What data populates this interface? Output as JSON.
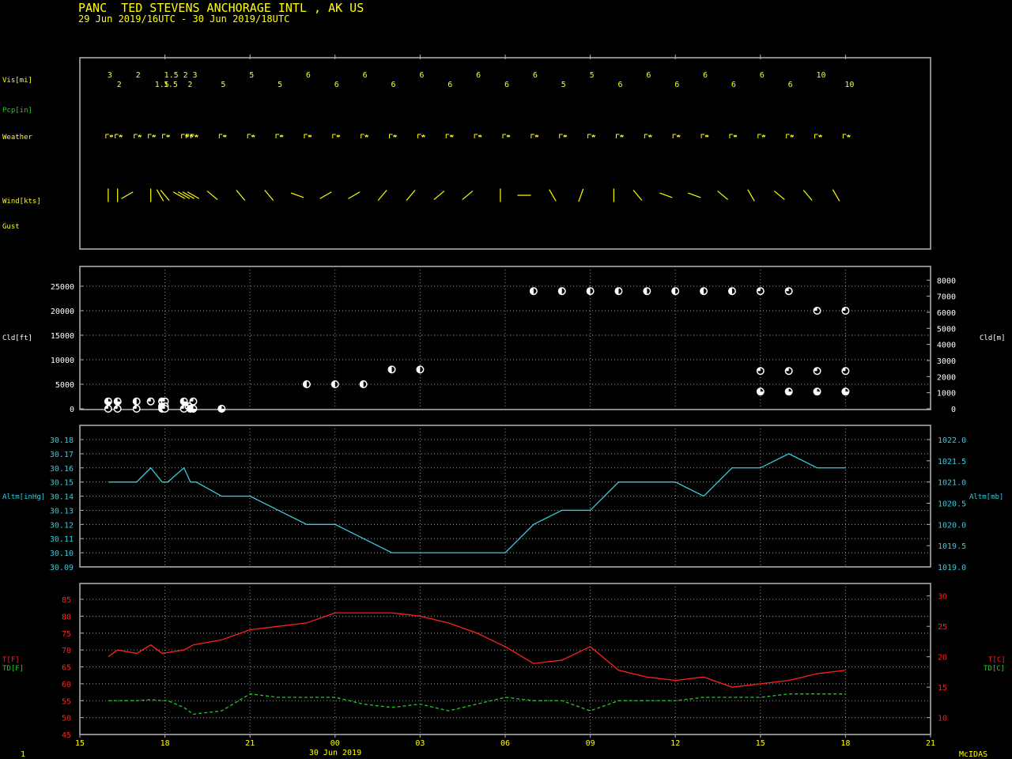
{
  "header": {
    "station_line": "PANC  TED STEVENS ANCHORAGE INTL , AK US",
    "period_line": "29 Jun 2019/16UTC - 30 Jun 2019/18UTC"
  },
  "footer": {
    "left_number": "1",
    "date_label": "30 Jun 2019",
    "brand": "McIDAS"
  },
  "colors": {
    "background": "#000000",
    "frame": "#b4b4b4",
    "yellow": "#ffff00",
    "green": "#22cc22",
    "cyan": "#33ccdd",
    "red": "#ff2020",
    "white": "#ffffff"
  },
  "chart_data": [
    {
      "type": "table",
      "panel": "surface-observations",
      "row_labels": {
        "vis": "Vis[mi]",
        "pcp": "Pcp[in]",
        "weather": "Weather",
        "wind": "Wind[kts]",
        "gust": "Gust"
      },
      "visibility_mi": [
        {
          "hour": 16.0,
          "text": "3"
        },
        {
          "hour": 16.33,
          "text": "2"
        },
        {
          "hour": 17.0,
          "text": "2"
        },
        {
          "hour": 17.67,
          "text": "1.5"
        },
        {
          "hour": 18.0,
          "text": "1.5"
        },
        {
          "hour": 17.98,
          "text": "1.5"
        },
        {
          "hour": 18.67,
          "text": "2"
        },
        {
          "hour": 18.83,
          "text": "2"
        },
        {
          "hour": 19.0,
          "text": "3"
        },
        {
          "hour": 20.0,
          "text": "5"
        },
        {
          "hour": 21.0,
          "text": "5"
        },
        {
          "hour": 22.0,
          "text": "5"
        },
        {
          "hour": 23.0,
          "text": "6"
        },
        {
          "hour": 24.0,
          "text": "6"
        },
        {
          "hour": 25.0,
          "text": "6"
        },
        {
          "hour": 26.0,
          "text": "6"
        },
        {
          "hour": 27.0,
          "text": "6"
        },
        {
          "hour": 28.0,
          "text": "6"
        },
        {
          "hour": 29.0,
          "text": "6"
        },
        {
          "hour": 30.0,
          "text": "6"
        },
        {
          "hour": 31.0,
          "text": "6"
        },
        {
          "hour": 32.0,
          "text": "5"
        },
        {
          "hour": 33.0,
          "text": "5"
        },
        {
          "hour": 34.0,
          "text": "6"
        },
        {
          "hour": 35.0,
          "text": "6"
        },
        {
          "hour": 36.0,
          "text": "6"
        },
        {
          "hour": 37.0,
          "text": "6"
        },
        {
          "hour": 38.0,
          "text": "6"
        },
        {
          "hour": 39.0,
          "text": "6"
        },
        {
          "hour": 40.0,
          "text": "6"
        },
        {
          "hour": 41.0,
          "text": "10"
        },
        {
          "hour": 42.0,
          "text": "10"
        }
      ],
      "weather_symbol": "haze",
      "weather_hours": [
        16.0,
        16.33,
        17.0,
        17.5,
        18.0,
        18.67,
        18.83,
        19.0,
        20.0,
        21.0,
        22.0,
        23.0,
        24.0,
        25.0,
        26.0,
        27.0,
        28.0,
        29.0,
        30.0,
        31.0,
        32.0,
        33.0,
        34.0,
        35.0,
        36.0,
        37.0,
        38.0,
        39.0,
        40.0,
        41.0,
        42.0
      ],
      "wind_barbs": [
        {
          "hour": 16.0,
          "dir_deg": 360
        },
        {
          "hour": 16.33,
          "dir_deg": 360
        },
        {
          "hour": 16.67,
          "dir_deg": 240
        },
        {
          "hour": 17.5,
          "dir_deg": 360
        },
        {
          "hour": 17.83,
          "dir_deg": 330
        },
        {
          "hour": 18.0,
          "dir_deg": 320
        },
        {
          "hour": 18.5,
          "dir_deg": 300
        },
        {
          "hour": 18.67,
          "dir_deg": 300
        },
        {
          "hour": 18.83,
          "dir_deg": 300
        },
        {
          "hour": 19.0,
          "dir_deg": 300
        },
        {
          "hour": 19.67,
          "dir_deg": 310
        },
        {
          "hour": 20.67,
          "dir_deg": 320
        },
        {
          "hour": 21.67,
          "dir_deg": 320
        },
        {
          "hour": 22.67,
          "dir_deg": 290
        },
        {
          "hour": 23.67,
          "dir_deg": 240
        },
        {
          "hour": 24.67,
          "dir_deg": 240
        },
        {
          "hour": 25.67,
          "dir_deg": 220
        },
        {
          "hour": 26.67,
          "dir_deg": 220
        },
        {
          "hour": 27.67,
          "dir_deg": 230
        },
        {
          "hour": 28.67,
          "dir_deg": 230
        },
        {
          "hour": 29.83,
          "dir_deg": 360
        },
        {
          "hour": 30.67,
          "dir_deg": 270
        },
        {
          "hour": 31.67,
          "dir_deg": 330
        },
        {
          "hour": 32.67,
          "dir_deg": 20
        },
        {
          "hour": 33.83,
          "dir_deg": 360
        },
        {
          "hour": 34.67,
          "dir_deg": 320
        },
        {
          "hour": 35.67,
          "dir_deg": 290
        },
        {
          "hour": 36.67,
          "dir_deg": 290
        },
        {
          "hour": 37.67,
          "dir_deg": 310
        },
        {
          "hour": 38.67,
          "dir_deg": 330
        },
        {
          "hour": 39.67,
          "dir_deg": 310
        },
        {
          "hour": 40.67,
          "dir_deg": 320
        },
        {
          "hour": 41.67,
          "dir_deg": 330
        }
      ]
    },
    {
      "type": "scatter",
      "panel": "cloud",
      "ylabel_left": "Cld[ft]",
      "ylabel_right": "Cld[m]",
      "ylim_ft": [
        0,
        25000
      ],
      "yticks_ft": [
        0,
        5000,
        10000,
        15000,
        20000,
        25000
      ],
      "yticks_m": [
        0,
        1000,
        2000,
        3000,
        4000,
        5000,
        6000,
        7000,
        8000
      ],
      "grid": true,
      "points": [
        {
          "hour": 16.0,
          "ft": 1500,
          "cover": "few"
        },
        {
          "hour": 16.0,
          "ft": 0,
          "cover": "bkn"
        },
        {
          "hour": 16.33,
          "ft": 1500,
          "cover": "few"
        },
        {
          "hour": 16.33,
          "ft": 0,
          "cover": "bkn"
        },
        {
          "hour": 17.0,
          "ft": 1500,
          "cover": "sct"
        },
        {
          "hour": 17.0,
          "ft": 0,
          "cover": "bkn"
        },
        {
          "hour": 17.5,
          "ft": 1500,
          "cover": "bkn"
        },
        {
          "hour": 17.9,
          "ft": 1500,
          "cover": "bkn"
        },
        {
          "hour": 17.9,
          "ft": 500,
          "cover": "bkn"
        },
        {
          "hour": 17.9,
          "ft": 0,
          "cover": "few"
        },
        {
          "hour": 18.0,
          "ft": 1500,
          "cover": "bkn"
        },
        {
          "hour": 18.0,
          "ft": 500,
          "cover": "bkn"
        },
        {
          "hour": 18.0,
          "ft": 0,
          "cover": "bkn"
        },
        {
          "hour": 18.67,
          "ft": 1500,
          "cover": "few"
        },
        {
          "hour": 18.67,
          "ft": 0,
          "cover": "bkn"
        },
        {
          "hour": 18.83,
          "ft": 500,
          "cover": "bkn"
        },
        {
          "hour": 18.9,
          "ft": 0,
          "cover": "few"
        },
        {
          "hour": 19.0,
          "ft": 1500,
          "cover": "bkn"
        },
        {
          "hour": 19.0,
          "ft": 0,
          "cover": "few"
        },
        {
          "hour": 20.0,
          "ft": 0,
          "cover": "few"
        },
        {
          "hour": 23.0,
          "ft": 5000,
          "cover": "sct"
        },
        {
          "hour": 24.0,
          "ft": 5000,
          "cover": "sct"
        },
        {
          "hour": 25.0,
          "ft": 5000,
          "cover": "sct"
        },
        {
          "hour": 26.0,
          "ft": 8000,
          "cover": "sct"
        },
        {
          "hour": 27.0,
          "ft": 8000,
          "cover": "sct"
        },
        {
          "hour": 31.0,
          "ft": 24000,
          "cover": "sct"
        },
        {
          "hour": 32.0,
          "ft": 24000,
          "cover": "sct"
        },
        {
          "hour": 33.0,
          "ft": 24000,
          "cover": "sct"
        },
        {
          "hour": 34.0,
          "ft": 24000,
          "cover": "sct"
        },
        {
          "hour": 35.0,
          "ft": 24000,
          "cover": "sct"
        },
        {
          "hour": 36.0,
          "ft": 24000,
          "cover": "sct"
        },
        {
          "hour": 37.0,
          "ft": 24000,
          "cover": "sct"
        },
        {
          "hour": 38.0,
          "ft": 24000,
          "cover": "sct"
        },
        {
          "hour": 39.0,
          "ft": 24000,
          "cover": "bkn"
        },
        {
          "hour": 40.0,
          "ft": 24000,
          "cover": "bkn"
        },
        {
          "hour": 41.0,
          "ft": 20000,
          "cover": "bkn"
        },
        {
          "hour": 42.0,
          "ft": 20000,
          "cover": "bkn"
        },
        {
          "hour": 39.0,
          "ft": 7700,
          "cover": "bkn"
        },
        {
          "hour": 40.0,
          "ft": 7700,
          "cover": "bkn"
        },
        {
          "hour": 41.0,
          "ft": 7700,
          "cover": "bkn"
        },
        {
          "hour": 42.0,
          "ft": 7700,
          "cover": "bkn"
        },
        {
          "hour": 39.0,
          "ft": 3500,
          "cover": "few"
        },
        {
          "hour": 40.0,
          "ft": 3500,
          "cover": "few"
        },
        {
          "hour": 41.0,
          "ft": 3500,
          "cover": "few"
        },
        {
          "hour": 42.0,
          "ft": 3500,
          "cover": "few"
        }
      ]
    },
    {
      "type": "line",
      "panel": "altimeter",
      "ylabel_left": "Altm[inHg]",
      "ylabel_right": "Altm[mb]",
      "ylim_inhg": [
        30.09,
        30.18
      ],
      "yticks_inhg": [
        "30.09",
        "30.10",
        "30.11",
        "30.12",
        "30.13",
        "30.14",
        "30.15",
        "30.16",
        "30.17",
        "30.18"
      ],
      "yticks_mb": [
        "1019.0",
        "1019.5",
        "1020.0",
        "1020.5",
        "1021.0",
        "1021.5",
        "1022.0"
      ],
      "grid": true,
      "x_hours": [
        16,
        17,
        17.5,
        17.9,
        18.1,
        18.67,
        18.9,
        19.1,
        20,
        21,
        22,
        23,
        24,
        25,
        26,
        27,
        28,
        29,
        30,
        31,
        32,
        33,
        34,
        35,
        36,
        37,
        38,
        39,
        40,
        41,
        42
      ],
      "values": [
        30.15,
        30.15,
        30.16,
        30.15,
        30.15,
        30.16,
        30.15,
        30.15,
        30.14,
        30.14,
        30.13,
        30.12,
        30.12,
        30.11,
        30.1,
        30.1,
        30.1,
        30.1,
        30.1,
        30.12,
        30.13,
        30.13,
        30.15,
        30.15,
        30.15,
        30.14,
        30.16,
        30.16,
        30.17,
        30.16,
        30.16
      ]
    },
    {
      "type": "line",
      "panel": "temperature",
      "ylabel_left": [
        "T[F]",
        "TD[F]"
      ],
      "ylabel_right": [
        "T[C]",
        "TD[C]"
      ],
      "ylim_f": [
        45,
        85
      ],
      "yticks_f": [
        45,
        50,
        55,
        60,
        65,
        70,
        75,
        80,
        85
      ],
      "yticks_c": [
        10,
        15,
        20,
        25,
        30
      ],
      "grid": true,
      "x_tick_labels": [
        "15",
        "18",
        "21",
        "00",
        "03",
        "06",
        "09",
        "12",
        "15",
        "18",
        "21"
      ],
      "series": [
        {
          "name": "T[F]",
          "x_hours": [
            16,
            16.33,
            17,
            17.5,
            17.9,
            18.67,
            19,
            20,
            21,
            22,
            23,
            24,
            25,
            26,
            27,
            28,
            29,
            30,
            31,
            32,
            33,
            34,
            35,
            36,
            37,
            38,
            39,
            40,
            41,
            42
          ],
          "values": [
            68,
            70,
            69,
            71.5,
            69,
            70,
            71.5,
            73,
            76,
            77,
            78,
            81,
            81,
            81,
            80,
            78,
            75,
            71,
            66,
            67,
            71,
            64,
            62,
            61,
            62,
            59,
            60,
            61,
            63,
            64
          ]
        },
        {
          "name": "TD[F]",
          "x_hours": [
            16,
            16.33,
            17,
            17.5,
            17.9,
            18.1,
            18.67,
            19,
            20,
            21,
            22,
            23,
            24,
            25,
            26,
            27,
            28,
            29,
            30,
            31,
            32,
            33,
            34,
            35,
            36,
            37,
            38,
            39,
            40,
            41,
            42
          ],
          "values": [
            55,
            55,
            55,
            55.3,
            55,
            55,
            53,
            51,
            52,
            57,
            56,
            56,
            56,
            54,
            53,
            54,
            52,
            54,
            56,
            55,
            55,
            52,
            55,
            55,
            55,
            56,
            56,
            56,
            57,
            57,
            57
          ]
        }
      ]
    }
  ]
}
